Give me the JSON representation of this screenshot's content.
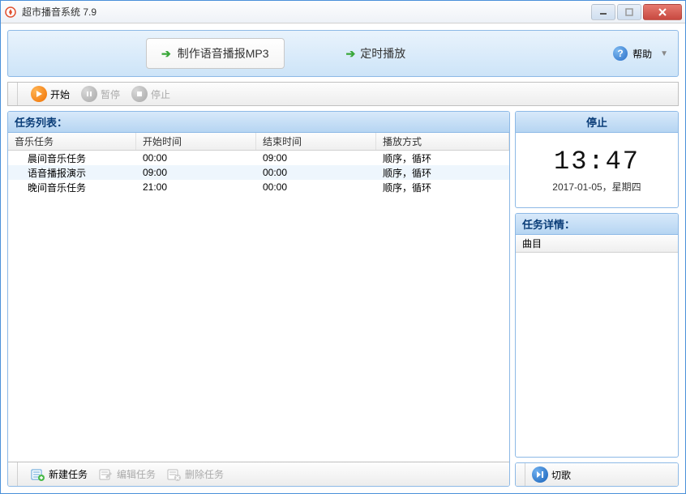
{
  "window": {
    "title": "超市播音系统 7.9"
  },
  "toolbar": {
    "make_mp3": "制作语音播报MP3",
    "timed_play": "定时播放",
    "help": "帮助"
  },
  "playbar": {
    "start": "开始",
    "pause": "暂停",
    "stop": "停止"
  },
  "taskList": {
    "header": "任务列表：",
    "columns": {
      "name": "音乐任务",
      "start": "开始时间",
      "end": "结束时间",
      "mode": "播放方式"
    },
    "rows": [
      {
        "name": "晨间音乐任务",
        "start": "00:00",
        "end": "09:00",
        "mode": "顺序，循环"
      },
      {
        "name": "语音播报演示",
        "start": "09:00",
        "end": "00:00",
        "mode": "顺序，循环"
      },
      {
        "name": "晚间音乐任务",
        "start": "21:00",
        "end": "00:00",
        "mode": "顺序，循环"
      }
    ]
  },
  "bottomBar": {
    "new": "新建任务",
    "edit": "编辑任务",
    "delete": "删除任务"
  },
  "status": {
    "state": "停止",
    "time": "13:47",
    "date": "2017-01-05，星期四"
  },
  "detail": {
    "header": "任务详情：",
    "column": "曲目"
  },
  "skip": {
    "label": "切歌"
  }
}
